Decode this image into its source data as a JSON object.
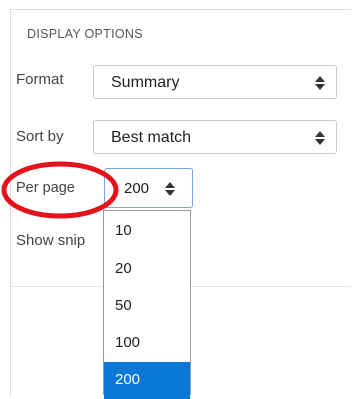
{
  "panel": {
    "title": "DISPLAY OPTIONS"
  },
  "format": {
    "label": "Format",
    "value": "Summary"
  },
  "sort": {
    "label": "Sort by",
    "value": "Best match"
  },
  "per_page": {
    "label": "Per page",
    "value": "200",
    "options": [
      "10",
      "20",
      "50",
      "100",
      "200"
    ],
    "selected_index": 4
  },
  "show_snippets": {
    "label": "Show snip"
  },
  "colors": {
    "highlight_ellipse": "#e4131b",
    "selected_option_bg": "#0b78d7",
    "focus_border": "#7aa7e0"
  }
}
